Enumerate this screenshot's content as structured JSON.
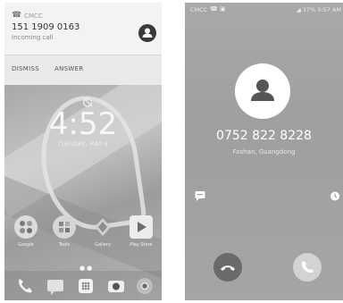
{
  "left_screen": {
    "notification": {
      "label": "CMCC",
      "caller_number": "151 1909 0163",
      "call_status": "Incoming call",
      "dismiss_label": "DISMISS",
      "answer_label": "ANSWER"
    },
    "lockscreen": {
      "time": "4:52",
      "date": "TUESDAY, MAY 9"
    },
    "apps": [
      {
        "label": "Google",
        "icon": "google-folder-icon"
      },
      {
        "label": "Tools",
        "icon": "tools-folder-icon"
      },
      {
        "label": "Gallery",
        "icon": "gallery-icon"
      },
      {
        "label": "Play Store",
        "icon": "play-store-icon"
      }
    ],
    "dock": [
      "phone-icon",
      "messages-icon",
      "app-drawer-icon",
      "camera-icon",
      "chrome-icon"
    ]
  },
  "right_screen": {
    "status_bar": {
      "carrier": "CMCC",
      "right": "37% 9:57 AM"
    },
    "caller": {
      "number": "0752 822 8228",
      "location": "Foshan, Guangdong"
    },
    "actions": [
      "message-icon",
      "reminder-icon",
      "decline-call-icon",
      "answer-call-icon"
    ]
  }
}
